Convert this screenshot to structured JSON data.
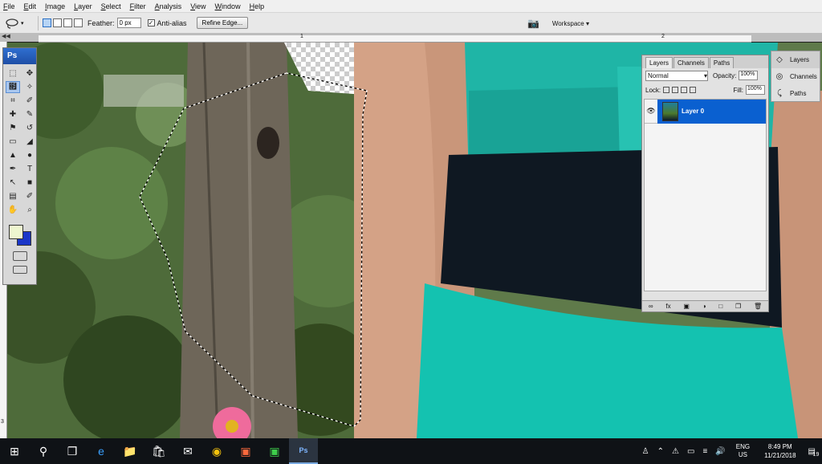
{
  "menu": [
    "File",
    "Edit",
    "Image",
    "Layer",
    "Select",
    "Filter",
    "Analysis",
    "View",
    "Window",
    "Help"
  ],
  "options": {
    "feather_label": "Feather:",
    "feather_value": "0 px",
    "antialias_label": "Anti-alias",
    "antialias_checked": true,
    "refine_edge_label": "Refine Edge...",
    "workspace_label": "Workspace ▾"
  },
  "rulers": {
    "top_labels": [
      "1",
      "2"
    ],
    "left_labels": [
      "3"
    ]
  },
  "tools": {
    "badge": "Ps",
    "items": [
      {
        "name": "marquee-tool-icon",
        "glyph": "⬚"
      },
      {
        "name": "move-tool-icon",
        "glyph": "✥"
      },
      {
        "name": "lasso-tool-icon",
        "glyph": "໏",
        "active": true
      },
      {
        "name": "magic-wand-tool-icon",
        "glyph": "✧"
      },
      {
        "name": "crop-tool-icon",
        "glyph": "⌗"
      },
      {
        "name": "eyedropper-tool-icon",
        "glyph": "✐"
      },
      {
        "name": "healing-brush-tool-icon",
        "glyph": "✚"
      },
      {
        "name": "brush-tool-icon",
        "glyph": "✎"
      },
      {
        "name": "clone-stamp-tool-icon",
        "glyph": "⚑"
      },
      {
        "name": "history-brush-tool-icon",
        "glyph": "↺"
      },
      {
        "name": "eraser-tool-icon",
        "glyph": "▭"
      },
      {
        "name": "paint-bucket-tool-icon",
        "glyph": "◢"
      },
      {
        "name": "blur-tool-icon",
        "glyph": "▲"
      },
      {
        "name": "dodge-tool-icon",
        "glyph": "●"
      },
      {
        "name": "pen-tool-icon",
        "glyph": "✒"
      },
      {
        "name": "type-tool-icon",
        "glyph": "T"
      },
      {
        "name": "path-selection-tool-icon",
        "glyph": "↖"
      },
      {
        "name": "shape-tool-icon",
        "glyph": "■"
      },
      {
        "name": "notes-tool-icon",
        "glyph": "▤"
      },
      {
        "name": "color-sampler-tool-icon",
        "glyph": "✐"
      },
      {
        "name": "hand-tool-icon",
        "glyph": "✋"
      },
      {
        "name": "zoom-tool-icon",
        "glyph": "⌕"
      }
    ],
    "colors": {
      "foreground": "#eef6cf",
      "background": "#1a36c8"
    }
  },
  "layers_panel": {
    "tabs": [
      "Layers",
      "Channels",
      "Paths"
    ],
    "blend_mode": "Normal",
    "opacity_label": "Opacity:",
    "opacity_value": "100%",
    "lock_label": "Lock:",
    "fill_label": "Fill:",
    "fill_value": "100%",
    "layers": [
      {
        "name": "Layer 0",
        "visible": true,
        "selected": true
      }
    ],
    "selection_color": "#0a60d0"
  },
  "dock": [
    "Layers",
    "Channels",
    "Paths"
  ],
  "taskbar": {
    "tray": {
      "lang": "ENG",
      "region": "US",
      "time": "8:49 PM",
      "date": "11/21/2018",
      "notifications": "19"
    }
  }
}
